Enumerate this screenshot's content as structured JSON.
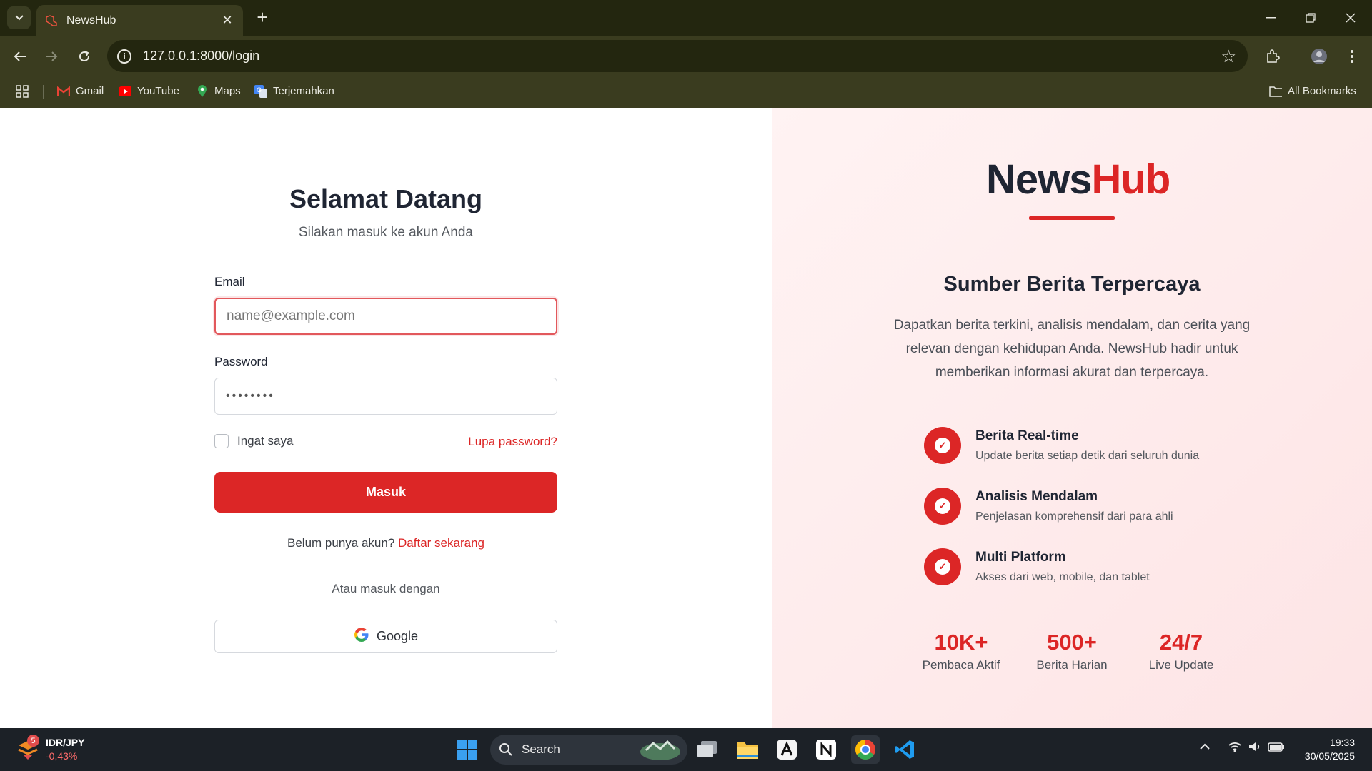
{
  "browser": {
    "tab_title": "NewsHub",
    "tab_close": "✕",
    "new_tab": "+",
    "url": "127.0.0.1:8000/login",
    "bookmarks": [
      {
        "label": "Gmail",
        "icon": "gmail-icon",
        "color": "#ea4335"
      },
      {
        "label": "YouTube",
        "icon": "youtube-icon",
        "color": "#ff0000"
      },
      {
        "label": "Maps",
        "icon": "maps-icon",
        "color": "#34a853"
      },
      {
        "label": "Terjemahkan",
        "icon": "translate-icon",
        "color": "#4285f4"
      }
    ],
    "all_bookmarks": "All Bookmarks"
  },
  "login": {
    "title": "Selamat Datang",
    "subtitle": "Silakan masuk ke akun Anda",
    "email_label": "Email",
    "email_placeholder": "name@example.com",
    "password_label": "Password",
    "password_value": "••••••••",
    "remember_label": "Ingat saya",
    "forgot_label": "Lupa password?",
    "submit_label": "Masuk",
    "register_prompt": "Belum punya akun?",
    "register_link": "Daftar sekarang",
    "divider_text": "Atau masuk dengan",
    "google_label": "Google"
  },
  "promo": {
    "brand_part1": "News",
    "brand_part2": "Hub",
    "tagline": "Sumber Berita Terpercaya",
    "description": "Dapatkan berita terkini, analisis mendalam, dan cerita yang relevan dengan kehidupan Anda. NewsHub hadir untuk memberikan informasi akurat dan terpercaya.",
    "features": [
      {
        "title": "Berita Real-time",
        "desc": "Update berita setiap detik dari seluruh dunia"
      },
      {
        "title": "Analisis Mendalam",
        "desc": "Penjelasan komprehensif dari para ahli"
      },
      {
        "title": "Multi Platform",
        "desc": "Akses dari web, mobile, dan tablet"
      }
    ],
    "stats": [
      {
        "num": "10K+",
        "label": "Pembaca Aktif"
      },
      {
        "num": "500+",
        "label": "Berita Harian"
      },
      {
        "num": "24/7",
        "label": "Live Update"
      }
    ],
    "accent_color": "#dc2626"
  },
  "taskbar": {
    "ticker_badge": "5",
    "ticker_pair": "IDR/JPY",
    "ticker_change": "-0,43%",
    "search_label": "Search",
    "time": "19:33",
    "date": "30/05/2025"
  }
}
